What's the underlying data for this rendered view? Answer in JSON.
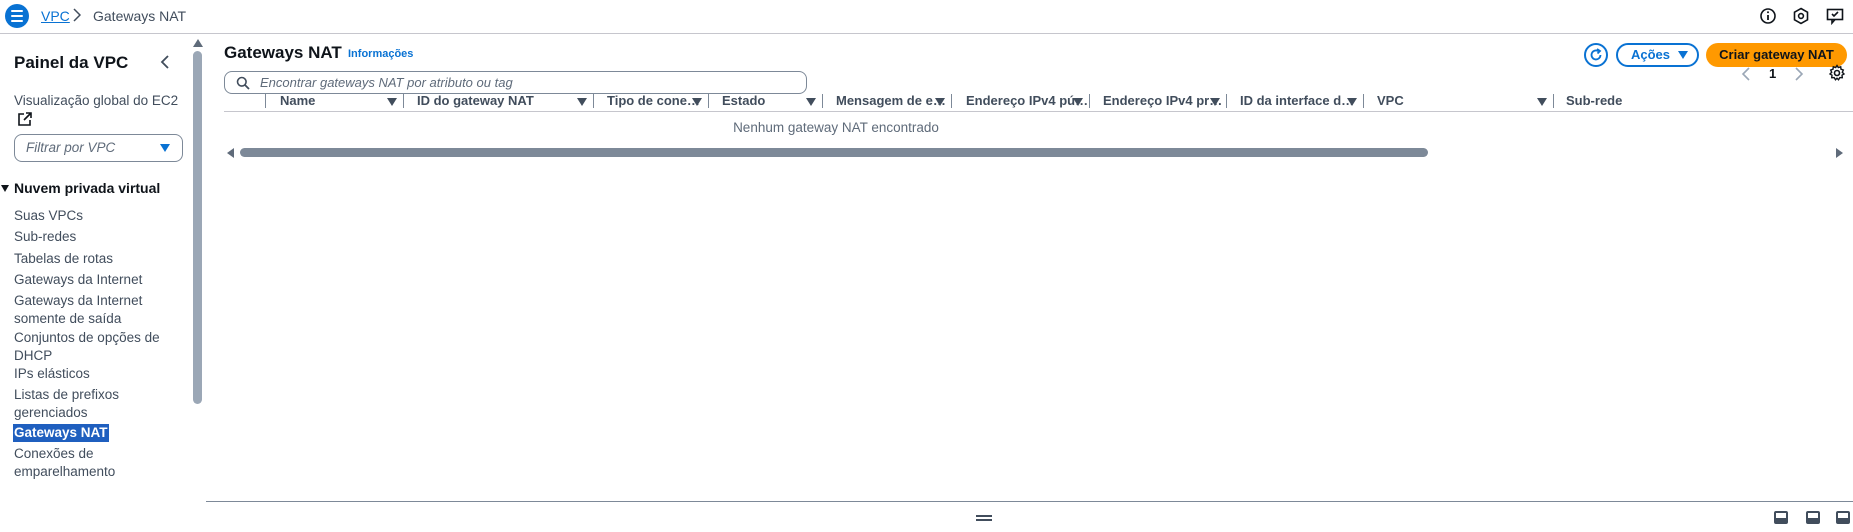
{
  "breadcrumb": {
    "items": [
      "VPC",
      "Gateways NAT"
    ]
  },
  "sidebar": {
    "title": "Painel da VPC",
    "global_view": "Visualização global do EC2",
    "filter_placeholder": "Filtrar por VPC",
    "section_title": "Nuvem privada virtual",
    "items": [
      "Suas VPCs",
      "Sub-redes",
      "Tabelas de rotas",
      "Gateways da Internet",
      "Gateways da Internet somente de saída",
      "Conjuntos de opções de DHCP",
      "IPs elásticos",
      "Listas de prefixos gerenciados",
      "Gateways NAT",
      "Conexões de emparelhamento"
    ],
    "active_item": "Gateways NAT"
  },
  "main": {
    "title": "Gateways NAT",
    "info_link": "Informações",
    "actions_label": "Ações",
    "create_label": "Criar gateway NAT",
    "search_placeholder": "Encontrar gateways NAT por atributo ou tag",
    "page_number": "1",
    "columns": [
      "Name",
      "ID do gateway NAT",
      "Tipo de cone…",
      "Estado",
      "Mensagem de e…",
      "Endereço IPv4 pú…",
      "Endereço IPv4 pr…",
      "ID da interface d…",
      "VPC",
      "Sub-rede"
    ],
    "empty_message": "Nenhum gateway NAT encontrado"
  },
  "colors": {
    "accent": "#0972d3",
    "primary_button": "#ff9900",
    "active_nav": "#1f5fbf"
  },
  "icons": [
    "menu-icon",
    "chevron-right-icon",
    "info-icon",
    "notifications-icon",
    "feedback-icon",
    "chevron-left-icon",
    "external-link-icon",
    "refresh-icon",
    "search-icon",
    "settings-icon"
  ]
}
